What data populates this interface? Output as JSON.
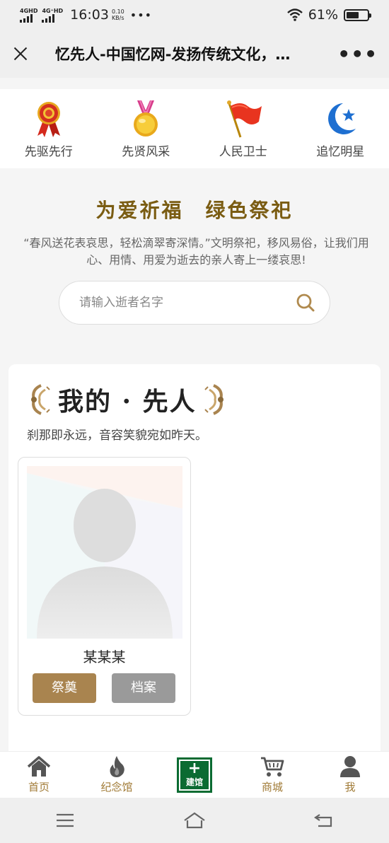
{
  "status_bar": {
    "net1": "4GHD",
    "net2": "4G⁺HD",
    "time": "16:03",
    "speed_value": "0.10",
    "speed_unit": "KB/s",
    "battery_percent": "61%",
    "battery_level": 0.61
  },
  "title_bar": {
    "title": "忆先人-中国忆网-发扬传统文化，…"
  },
  "categories": [
    {
      "label": "先驱先行",
      "icon": "ribbon-medal-icon"
    },
    {
      "label": "先贤风采",
      "icon": "gold-medal-icon"
    },
    {
      "label": "人民卫士",
      "icon": "red-flag-icon"
    },
    {
      "label": "追忆明星",
      "icon": "crescent-star-icon"
    }
  ],
  "hero": {
    "title": "为爱祈福　绿色祭祀",
    "description": "“春风送花表哀思，轻松滴翠寄深情。”文明祭祀，移风易俗，让我们用心、用情、用爱为逝去的亲人寄上一缕哀思!"
  },
  "search": {
    "placeholder": "请输入逝者名字",
    "value": ""
  },
  "my_ancestors": {
    "title": "我的 · 先人",
    "subtitle": "刹那即永远，音容笑貌宛如昨天。",
    "persons": [
      {
        "name": "某某某",
        "mourn_label": "祭奠",
        "archive_label": "档案"
      }
    ]
  },
  "tab_bar": {
    "items": [
      {
        "label": "首页",
        "icon": "home-icon"
      },
      {
        "label": "纪念馆",
        "icon": "flame-icon"
      },
      {
        "label": "建馆",
        "plus": "+",
        "icon": "build-hall-icon"
      },
      {
        "label": "商城",
        "icon": "cart-icon"
      },
      {
        "label": "我",
        "icon": "user-icon"
      }
    ]
  },
  "colors": {
    "accent_gold": "#a9844f",
    "title_brown": "#7a5c12",
    "build_green": "#0b6b32",
    "archive_gray": "#9a9a9a"
  }
}
